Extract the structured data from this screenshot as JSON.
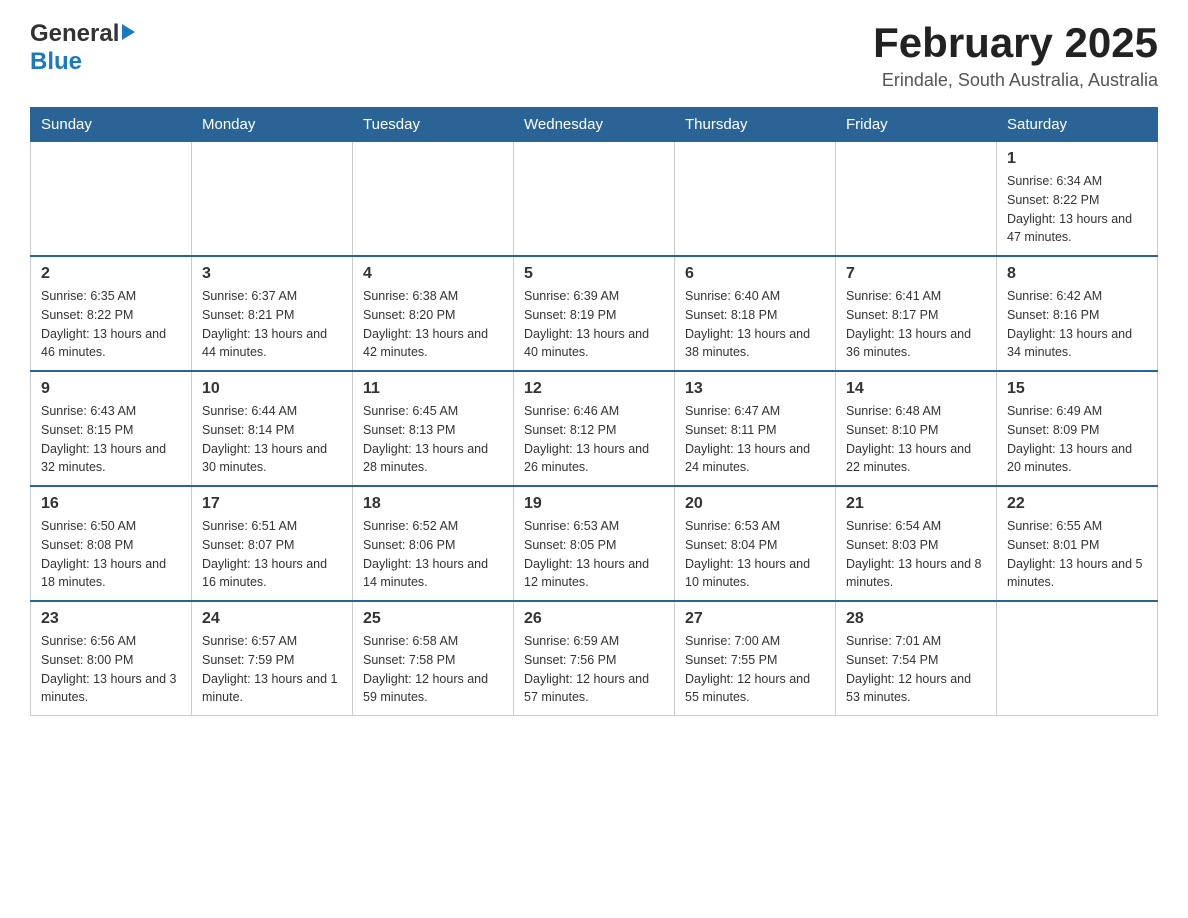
{
  "header": {
    "logo_general": "General",
    "logo_blue": "Blue",
    "month_title": "February 2025",
    "location": "Erindale, South Australia, Australia"
  },
  "days_of_week": [
    "Sunday",
    "Monday",
    "Tuesday",
    "Wednesday",
    "Thursday",
    "Friday",
    "Saturday"
  ],
  "weeks": [
    [
      {
        "day": "",
        "info": ""
      },
      {
        "day": "",
        "info": ""
      },
      {
        "day": "",
        "info": ""
      },
      {
        "day": "",
        "info": ""
      },
      {
        "day": "",
        "info": ""
      },
      {
        "day": "",
        "info": ""
      },
      {
        "day": "1",
        "info": "Sunrise: 6:34 AM\nSunset: 8:22 PM\nDaylight: 13 hours and 47 minutes."
      }
    ],
    [
      {
        "day": "2",
        "info": "Sunrise: 6:35 AM\nSunset: 8:22 PM\nDaylight: 13 hours and 46 minutes."
      },
      {
        "day": "3",
        "info": "Sunrise: 6:37 AM\nSunset: 8:21 PM\nDaylight: 13 hours and 44 minutes."
      },
      {
        "day": "4",
        "info": "Sunrise: 6:38 AM\nSunset: 8:20 PM\nDaylight: 13 hours and 42 minutes."
      },
      {
        "day": "5",
        "info": "Sunrise: 6:39 AM\nSunset: 8:19 PM\nDaylight: 13 hours and 40 minutes."
      },
      {
        "day": "6",
        "info": "Sunrise: 6:40 AM\nSunset: 8:18 PM\nDaylight: 13 hours and 38 minutes."
      },
      {
        "day": "7",
        "info": "Sunrise: 6:41 AM\nSunset: 8:17 PM\nDaylight: 13 hours and 36 minutes."
      },
      {
        "day": "8",
        "info": "Sunrise: 6:42 AM\nSunset: 8:16 PM\nDaylight: 13 hours and 34 minutes."
      }
    ],
    [
      {
        "day": "9",
        "info": "Sunrise: 6:43 AM\nSunset: 8:15 PM\nDaylight: 13 hours and 32 minutes."
      },
      {
        "day": "10",
        "info": "Sunrise: 6:44 AM\nSunset: 8:14 PM\nDaylight: 13 hours and 30 minutes."
      },
      {
        "day": "11",
        "info": "Sunrise: 6:45 AM\nSunset: 8:13 PM\nDaylight: 13 hours and 28 minutes."
      },
      {
        "day": "12",
        "info": "Sunrise: 6:46 AM\nSunset: 8:12 PM\nDaylight: 13 hours and 26 minutes."
      },
      {
        "day": "13",
        "info": "Sunrise: 6:47 AM\nSunset: 8:11 PM\nDaylight: 13 hours and 24 minutes."
      },
      {
        "day": "14",
        "info": "Sunrise: 6:48 AM\nSunset: 8:10 PM\nDaylight: 13 hours and 22 minutes."
      },
      {
        "day": "15",
        "info": "Sunrise: 6:49 AM\nSunset: 8:09 PM\nDaylight: 13 hours and 20 minutes."
      }
    ],
    [
      {
        "day": "16",
        "info": "Sunrise: 6:50 AM\nSunset: 8:08 PM\nDaylight: 13 hours and 18 minutes."
      },
      {
        "day": "17",
        "info": "Sunrise: 6:51 AM\nSunset: 8:07 PM\nDaylight: 13 hours and 16 minutes."
      },
      {
        "day": "18",
        "info": "Sunrise: 6:52 AM\nSunset: 8:06 PM\nDaylight: 13 hours and 14 minutes."
      },
      {
        "day": "19",
        "info": "Sunrise: 6:53 AM\nSunset: 8:05 PM\nDaylight: 13 hours and 12 minutes."
      },
      {
        "day": "20",
        "info": "Sunrise: 6:53 AM\nSunset: 8:04 PM\nDaylight: 13 hours and 10 minutes."
      },
      {
        "day": "21",
        "info": "Sunrise: 6:54 AM\nSunset: 8:03 PM\nDaylight: 13 hours and 8 minutes."
      },
      {
        "day": "22",
        "info": "Sunrise: 6:55 AM\nSunset: 8:01 PM\nDaylight: 13 hours and 5 minutes."
      }
    ],
    [
      {
        "day": "23",
        "info": "Sunrise: 6:56 AM\nSunset: 8:00 PM\nDaylight: 13 hours and 3 minutes."
      },
      {
        "day": "24",
        "info": "Sunrise: 6:57 AM\nSunset: 7:59 PM\nDaylight: 13 hours and 1 minute."
      },
      {
        "day": "25",
        "info": "Sunrise: 6:58 AM\nSunset: 7:58 PM\nDaylight: 12 hours and 59 minutes."
      },
      {
        "day": "26",
        "info": "Sunrise: 6:59 AM\nSunset: 7:56 PM\nDaylight: 12 hours and 57 minutes."
      },
      {
        "day": "27",
        "info": "Sunrise: 7:00 AM\nSunset: 7:55 PM\nDaylight: 12 hours and 55 minutes."
      },
      {
        "day": "28",
        "info": "Sunrise: 7:01 AM\nSunset: 7:54 PM\nDaylight: 12 hours and 53 minutes."
      },
      {
        "day": "",
        "info": ""
      }
    ]
  ]
}
